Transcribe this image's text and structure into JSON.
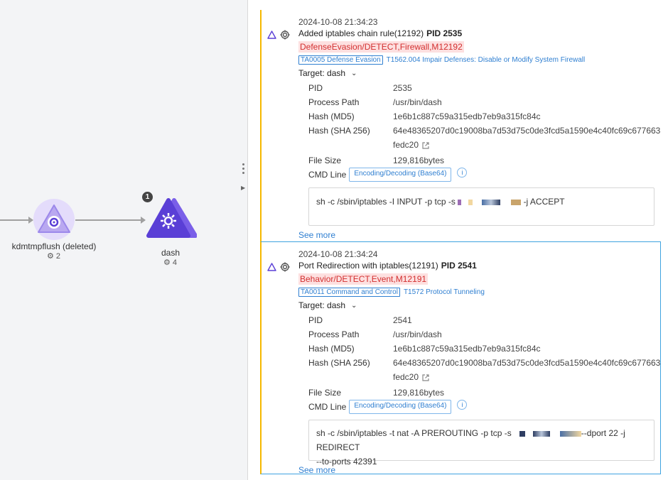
{
  "graph": {
    "nodes": [
      {
        "label": "kdmtmpflush (deleted)",
        "count": "2",
        "badge": ""
      },
      {
        "label": "dash",
        "count": "4",
        "badge": "1"
      }
    ],
    "colors": {
      "node_light": "#b9a8f0",
      "node_dark": "#5a3fd6",
      "edge": "#a0a0a0"
    }
  },
  "events": [
    {
      "timestamp": "2024-10-08 21:34:23",
      "title": "Added iptables chain rule(12192)",
      "pid_label": "PID 2535",
      "rule": "DefenseEvasion/DETECT,Firewall,M12192",
      "tactic": "TA0005 Defense Evasion",
      "technique": "T1562.004 Impair Defenses: Disable or Modify System Firewall",
      "target": "Target: dash",
      "fields": {
        "pid_k": "PID",
        "pid_v": "2535",
        "path_k": "Process Path",
        "path_v": "/usr/bin/dash",
        "md5_k": "Hash (MD5)",
        "md5_v": "1e6b1c887c59a315edb7eb9a315fc84c",
        "sha_k": "Hash (SHA 256)",
        "sha_v1": "64e48365207d0c19008ba7d53d75c0de3fcd5a1590e4c40fc69c677663",
        "sha_v2": "fedc20",
        "size_k": "File Size",
        "size_v": "129,816bytes",
        "cmd_k": "CMD Line",
        "cmd_chip": "Encoding/Decoding (Base64)"
      },
      "cmd_a": "sh -c /sbin/iptables -I INPUT -p tcp -s",
      "cmd_b": "-j ACCEPT",
      "cmd_c": "",
      "see_more": "See more"
    },
    {
      "timestamp": "2024-10-08 21:34:24",
      "title": "Port Redirection with iptables(12191)",
      "pid_label": "PID 2541",
      "rule": "Behavior/DETECT,Event,M12191",
      "tactic": "TA0011 Command and Control",
      "technique": "T1572 Protocol Tunneling",
      "target": "Target: dash",
      "fields": {
        "pid_k": "PID",
        "pid_v": "2541",
        "path_k": "Process Path",
        "path_v": "/usr/bin/dash",
        "md5_k": "Hash (MD5)",
        "md5_v": "1e6b1c887c59a315edb7eb9a315fc84c",
        "sha_k": "Hash (SHA 256)",
        "sha_v1": "64e48365207d0c19008ba7d53d75c0de3fcd5a1590e4c40fc69c677663",
        "sha_v2": "fedc20",
        "size_k": "File Size",
        "size_v": "129,816bytes",
        "cmd_k": "CMD Line",
        "cmd_chip": "Encoding/Decoding (Base64)"
      },
      "cmd_a": "sh -c /sbin/iptables -t nat -A PREROUTING -p tcp -s",
      "cmd_b": "--dport 22 -j REDIRECT",
      "cmd_c": "--to-ports 42391",
      "see_more": "See more"
    }
  ],
  "icons": [
    "triangle-alert-icon",
    "gear-icon",
    "external-link-icon",
    "info-icon",
    "chevron-down-icon"
  ]
}
